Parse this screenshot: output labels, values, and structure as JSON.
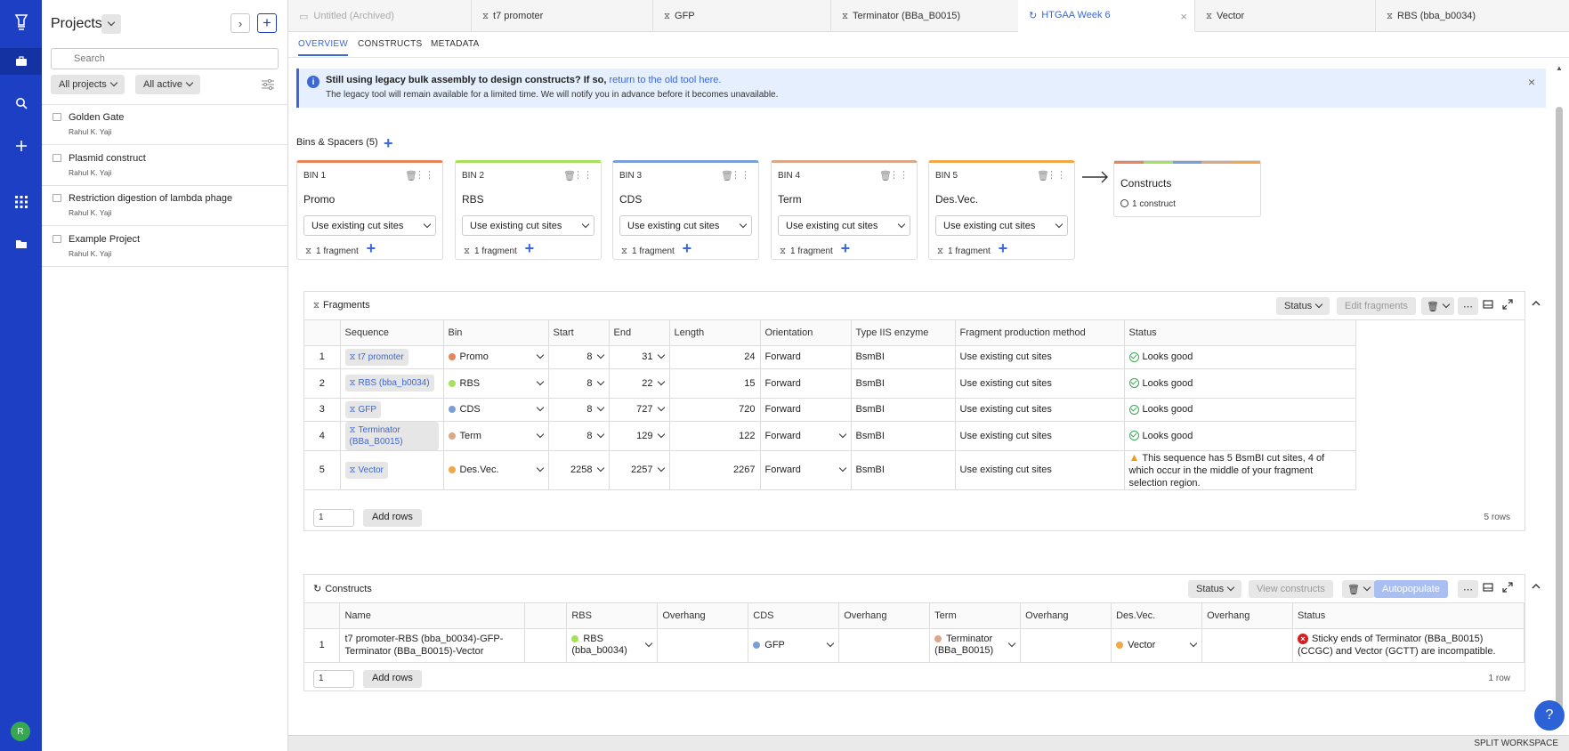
{
  "rail": {
    "icons": [
      "logo-icon",
      "briefcase-icon",
      "search-icon",
      "plus-icon",
      "apps-icon",
      "folder-icon"
    ],
    "avatar": "R"
  },
  "projects": {
    "title": "Projects",
    "search_placeholder": "Search",
    "filter_all": "All projects",
    "filter_active": "All active",
    "items": [
      {
        "name": "Golden Gate",
        "author": "Rahul K. Yaji"
      },
      {
        "name": "Plasmid construct",
        "author": "Rahul K. Yaji"
      },
      {
        "name": "Restriction digestion of lambda phage",
        "author": "Rahul K. Yaji"
      },
      {
        "name": "Example Project",
        "author": "Rahul K. Yaji"
      }
    ]
  },
  "tabs": [
    {
      "label": "Untitled (Archived)"
    },
    {
      "label": "t7 promoter"
    },
    {
      "label": "GFP"
    },
    {
      "label": "Terminator (BBa_B0015)"
    },
    {
      "label": "HTGAA Week 6"
    },
    {
      "label": "Vector"
    },
    {
      "label": "RBS (bba_b0034)"
    }
  ],
  "subtabs": [
    "OVERVIEW",
    "CONSTRUCTS",
    "METADATA"
  ],
  "banner": {
    "bold": "Still using legacy bulk assembly to design constructs? If so,",
    "link": "return to the old tool here.",
    "line2": "The legacy tool will remain available for a limited time. We will notify you in advance before it becomes unavailable."
  },
  "bins_header": "Bins & Spacers (5)",
  "bins": [
    {
      "label": "BIN 1",
      "name": "Promo",
      "select": "Use existing cut sites",
      "fragments": "1 fragment",
      "color": "#e8845a"
    },
    {
      "label": "BIN 2",
      "name": "RBS",
      "select": "Use existing cut sites",
      "fragments": "1 fragment",
      "color": "#a6e15a"
    },
    {
      "label": "BIN 3",
      "name": "CDS",
      "select": "Use existing cut sites",
      "fragments": "1 fragment",
      "color": "#7a9fd6"
    },
    {
      "label": "BIN 4",
      "name": "Term",
      "select": "Use existing cut sites",
      "fragments": "1 fragment",
      "color": "#d9a887"
    },
    {
      "label": "BIN 5",
      "name": "Des.Vec.",
      "select": "Use existing cut sites",
      "fragments": "1 fragment",
      "color": "#f0a848"
    }
  ],
  "constructs_card": {
    "title": "Constructs",
    "count": "1 construct"
  },
  "fragments": {
    "title": "Fragments",
    "status_btn": "Status",
    "edit_btn": "Edit fragments",
    "columns": [
      "",
      "Sequence",
      "Bin",
      "Start",
      "End",
      "Length",
      "Orientation",
      "Type IIS enzyme",
      "Fragment production method",
      "Status"
    ],
    "rows": [
      {
        "n": "1",
        "seq": "t7 promoter",
        "bin": "Promo",
        "bincolor": "#e8845a",
        "start": "8",
        "end": "31",
        "len": "24",
        "orient": "Forward",
        "enzyme": "BsmBI",
        "method": "Use existing cut sites",
        "status": "Looks good"
      },
      {
        "n": "2",
        "seq": "RBS (bba_b0034)",
        "bin": "RBS",
        "bincolor": "#a6e15a",
        "start": "8",
        "end": "22",
        "len": "15",
        "orient": "Forward",
        "enzyme": "BsmBI",
        "method": "Use existing cut sites",
        "status": "Looks good"
      },
      {
        "n": "3",
        "seq": "GFP",
        "bin": "CDS",
        "bincolor": "#7a9fd6",
        "start": "8",
        "end": "727",
        "len": "720",
        "orient": "Forward",
        "enzyme": "BsmBI",
        "method": "Use existing cut sites",
        "status": "Looks good"
      },
      {
        "n": "4",
        "seq": "Terminator (BBa_B0015)",
        "bin": "Term",
        "bincolor": "#d9a887",
        "start": "8",
        "end": "129",
        "len": "122",
        "orient": "Forward",
        "enzyme": "BsmBI",
        "method": "Use existing cut sites",
        "status": "Looks good"
      },
      {
        "n": "5",
        "seq": "Vector",
        "bin": "Des.Vec.",
        "bincolor": "#f0a848",
        "start": "2258",
        "end": "2257",
        "len": "2267",
        "orient": "Forward",
        "enzyme": "BsmBI",
        "method": "Use existing cut sites",
        "status": "This sequence has 5 BsmBI cut sites, 4 of which occur in the middle of your fragment selection region."
      }
    ],
    "rows_input": "1",
    "add_rows": "Add rows",
    "row_count": "5 rows"
  },
  "constructs": {
    "title": "Constructs",
    "status_btn": "Status",
    "view_btn": "View constructs",
    "autopopulate_btn": "Autopopulate",
    "columns": [
      "",
      "Name",
      "",
      "RBS",
      "Overhang",
      "CDS",
      "Overhang",
      "Term",
      "Overhang",
      "Des.Vec.",
      "Overhang",
      "Status"
    ],
    "rows": [
      {
        "n": "1",
        "name": "t7 promoter-RBS (bba_b0034)-GFP-Terminator (BBa_B0015)-Vector",
        "rbs": "RBS (bba_b0034)",
        "cds": "GFP",
        "term": "Terminator (BBa_B0015)",
        "vec": "Vector",
        "status": "Sticky ends of Terminator (BBa_B0015) (CCGC) and Vector (GCTT) are incompatible."
      }
    ],
    "rows_input": "1",
    "add_rows": "Add rows",
    "row_count": "1 row"
  },
  "statusbar": {
    "split": "SPLIT WORKSPACE"
  },
  "help": "?"
}
